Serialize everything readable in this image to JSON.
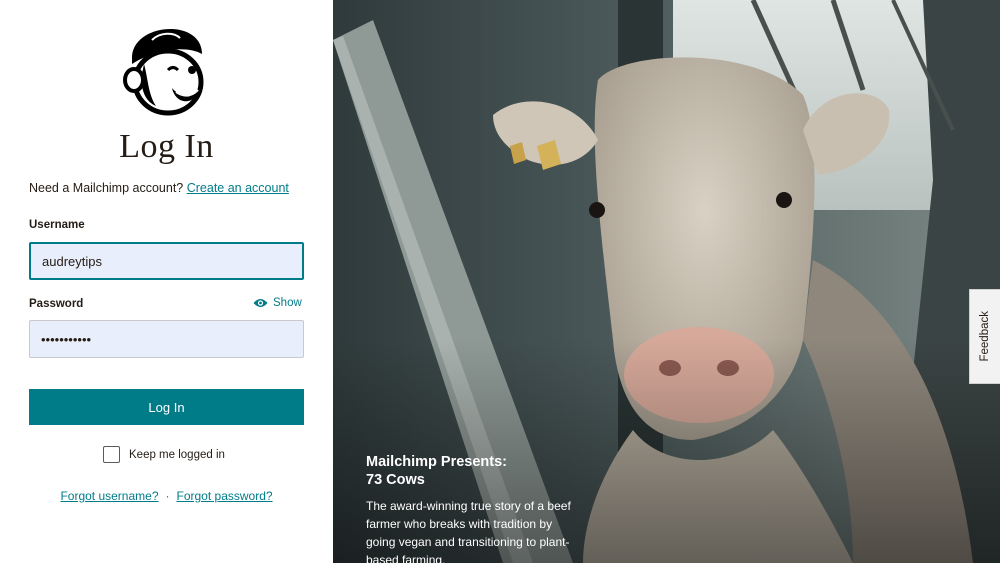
{
  "login": {
    "title": "Log In",
    "signup_prompt": "Need a Mailchimp account?",
    "signup_link": "Create an account",
    "username_label": "Username",
    "username_value": "audreytips",
    "password_label": "Password",
    "password_value": "•••••••••••",
    "show_label": "Show",
    "login_button": "Log In",
    "keep_logged_in": "Keep me logged in",
    "forgot_username": "Forgot username?",
    "forgot_separator": "·",
    "forgot_password": "Forgot password?"
  },
  "promo": {
    "title_line1": "Mailchimp Presents:",
    "title_line2": "73 Cows",
    "body": "The award-winning true story of a beef farmer who breaks with tradition by going vegan and transitioning to plant-based farming."
  },
  "feedback_tab": "Feedback",
  "icons": {
    "logo": "mailchimp-freddie-logo",
    "show": "eye-icon"
  },
  "colors": {
    "accent": "#007c89",
    "input_bg": "#e8eefb",
    "text": "#241c15"
  }
}
